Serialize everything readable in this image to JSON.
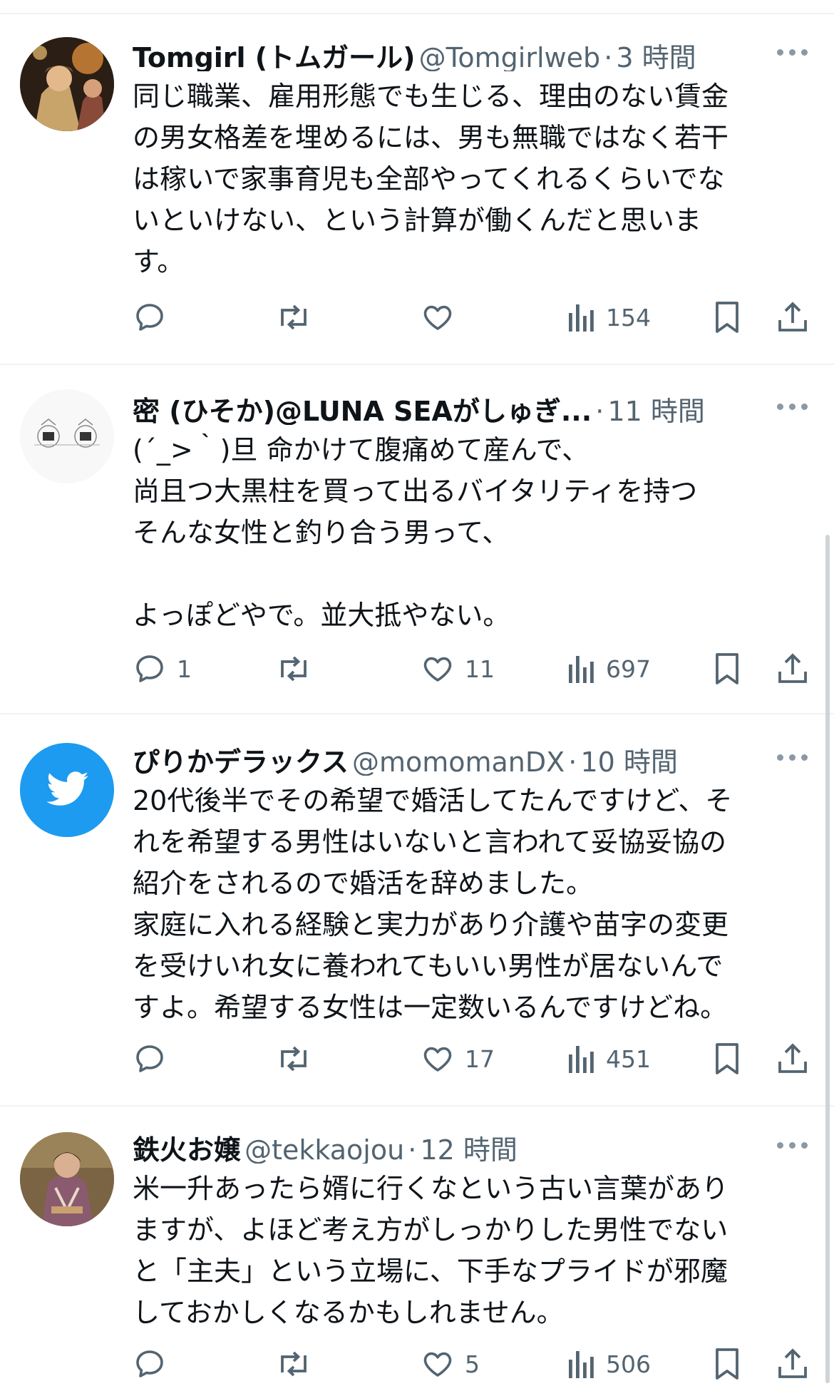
{
  "colors": {
    "accent": "#1d9bf0",
    "text": "#0f1419",
    "muted": "#536471",
    "divider": "#eff3f4"
  },
  "tweets": [
    {
      "name": "Tomgirl (トムガール)",
      "handle": "@Tomgirlweb",
      "dot": "·",
      "time": "3 時間",
      "avatar_icon": "user-photo-avatar",
      "text": "同じ職業、雇用形態でも生じる、理由のない賃金\nの男女格差を埋めるには、男も無職ではなく若干\nは稼いで家事育児も全部やってくれるくらいでな\nいといけない、という計算が働くんだと思いま\nす。",
      "replies": "",
      "retweets": "",
      "likes": "",
      "views": "154"
    },
    {
      "name": "密 (ひそか)@LUNA SEAがしゅぎ...",
      "handle": "",
      "dot": "·",
      "time": "11 時間",
      "avatar_icon": "illustration-avatar",
      "text": "(´_>｀)旦 命かけて腹痛めて産んで、\n尚且つ大黒柱を買って出るバイタリティを持つ\nそんな女性と釣り合う男って、\n\nよっぽどやで。並大抵やない。",
      "replies": "1",
      "retweets": "",
      "likes": "11",
      "views": "697"
    },
    {
      "name": "ぴりかデラックス",
      "handle": "@momomanDX",
      "dot": "·",
      "time": "10 時間",
      "avatar_icon": "twitter-bird-avatar",
      "text": "20代後半でその希望で婚活してたんですけど、そ\nれを希望する男性はいないと言われて妥協妥協の\n紹介をされるので婚活を辞めました。\n家庭に入れる経験と実力があり介護や苗字の変更\nを受けいれ女に養われてもいい男性が居ないんで\nすよ。希望する女性は一定数いるんですけどね。",
      "replies": "",
      "retweets": "",
      "likes": "17",
      "views": "451"
    },
    {
      "name": "鉄火お嬢",
      "handle": "@tekkaojou",
      "dot": "·",
      "time": "12 時間",
      "avatar_icon": "kimono-photo-avatar",
      "text": "米一升あったら婿に行くなという古い言葉があり\nますが、よほど考え方がしっかりした男性でない\nと「主夫」という立場に、下手なプライドが邪魔\nしておかしくなるかもしれません。",
      "replies": "",
      "retweets": "",
      "likes": "5",
      "views": "506"
    }
  ]
}
